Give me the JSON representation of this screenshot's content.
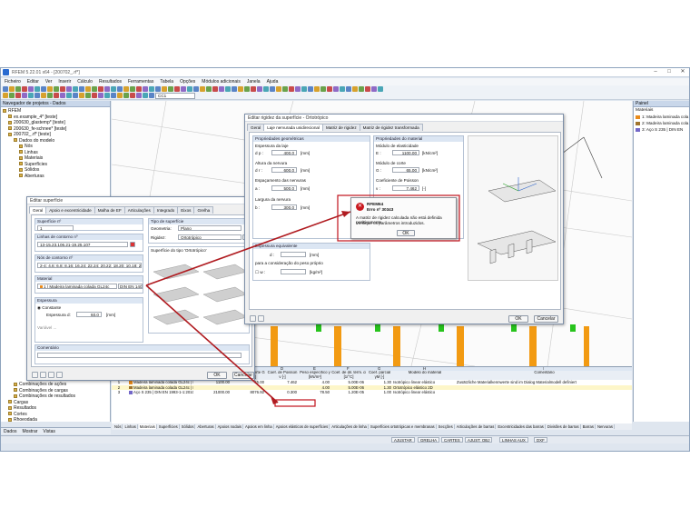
{
  "window": {
    "title": "RFEM 5.22.01 x64 - [200702_.rf*]",
    "min": "–",
    "max": "□",
    "close": "✕"
  },
  "menu": [
    "Ficheiro",
    "Editar",
    "Ver",
    "Inserir",
    "Cálculo",
    "Resultados",
    "Ferramentas",
    "Tabela",
    "Opções",
    "Módulos adicionais",
    "Janela",
    "Ajuda"
  ],
  "toolbar": {
    "loadcase": "CC1"
  },
  "navigator": {
    "header": "Navegador de projetos - Dados",
    "items": [
      {
        "label": "RFEM",
        "indent": 0
      },
      {
        "label": "ex.example_4* [teste]",
        "indent": 1
      },
      {
        "label": "200630_glastemp* [teste]",
        "indent": 1
      },
      {
        "label": "200630_fe-schnee* [teste]",
        "indent": 1
      },
      {
        "label": "200702_.rf* [teste]",
        "indent": 1
      },
      {
        "label": "Dados do modelo",
        "indent": 2
      },
      {
        "label": "Nós",
        "indent": 3
      },
      {
        "label": "Linhas",
        "indent": 3
      },
      {
        "label": "Materiais",
        "indent": 3
      },
      {
        "label": "Superfícies",
        "indent": 3
      },
      {
        "label": "Sólidos",
        "indent": 3
      },
      {
        "label": "Aberturas",
        "indent": 3
      }
    ],
    "lower_items": [
      {
        "label": "Combinações de ações",
        "indent": 2
      },
      {
        "label": "Combinações de cargas",
        "indent": 2
      },
      {
        "label": "Combinações de resultados",
        "indent": 2
      },
      {
        "label": "Cargas",
        "indent": 1
      },
      {
        "label": "Resultados",
        "indent": 1
      },
      {
        "label": "Cortes",
        "indent": 1
      },
      {
        "label": "Rhoeodada",
        "indent": 1
      }
    ],
    "tabs": [
      "Dados",
      "Mostrar",
      "Vistas"
    ]
  },
  "right_panel": {
    "header": "Painel",
    "subheader": "Materiais",
    "items": [
      {
        "label": "1: Madeira laminada cola",
        "color": "#e98b1c"
      },
      {
        "label": "2: Madeira laminada cola",
        "color": "#a0742e"
      },
      {
        "label": "3: Aço S 235 | DIN EN",
        "color": "#7367c8"
      }
    ]
  },
  "surface_dialog": {
    "title": "Editar superfície",
    "tabs": [
      "Geral",
      "Apoio e excentricidade",
      "Malha de EF",
      "Articulações",
      "Integrado",
      "Eixos",
      "Grelha"
    ],
    "surface_no_label": "Superfície nº",
    "surface_no": "1",
    "type_label": "Tipo de superfície",
    "geometry_label": "Geometria:",
    "geometry_value": "Plano",
    "stiffness_label": "Rigidez:",
    "stiffness_value": "Ortotrópico",
    "boundary_label": "Linhas de contorno nº",
    "boundary_value": "13-15,23,106,21-19,25,107",
    "boundary_nodes_label": "Nós de contorno nº",
    "boundary_nodes_value": "2-4; 4,6; 6,8; 8,16; 16,24; 22,24; 20,22; 18,20; 10,18; 2,10",
    "material_label": "Material",
    "material_no": "1",
    "material_value": "Madeira laminada colada GL24c",
    "material_norm": "DIN EN 14080:20",
    "preview_label": "Superfície do tipo 'Ortotrópico'",
    "thickness_label": "Espessura",
    "constant_label": "Constante",
    "variable_label": "Variável ...",
    "thickness_d_label": "Espessura d:",
    "thickness_d_value": "60.0",
    "thickness_unit": "[mm]",
    "comment_label": "Comentário",
    "ok": "OK",
    "cancel": "Cancelar"
  },
  "stiffness_dialog": {
    "title": "Editar rigidez da superfície - Ortotrópico",
    "tabs": [
      "Geral",
      "Laje nervurada unidirecional",
      "Matriz de rigidez",
      "Matriz de rigidez transformada"
    ],
    "geom_header": "Propriedades geométricas",
    "slab_thickness_label": "Espessura da laje",
    "dp_label": "d p :",
    "dp_value": "400.0",
    "rib_height_label": "Altura da nervura",
    "dr_label": "d r :",
    "dr_value": "600.0",
    "rib_spacing_label": "Espaçamento das nervuras",
    "a_label": "a :",
    "a_value": "500.0",
    "rib_width_label": "Largura da nervura",
    "b_label": "b :",
    "b_value": "300.0",
    "unit_mm": "[mm]",
    "mat_header": "Propriedades do material",
    "e_label": "Módulo de elasticidade",
    "e_sym": "E :",
    "e_value": "1100.00",
    "e_unit": "[kN/cm²]",
    "g_label": "Módulo de corte",
    "g_sym": "G :",
    "g_value": "65.00",
    "g_unit": "[kN/cm²]",
    "nu_label": "Coeficiente de Poisson",
    "nu_sym": "ν :",
    "nu_value": "7.462",
    "nu_unit": "[-]",
    "ym_sym": "γM :",
    "ym_value": "1.30",
    "ym_unit": "[-]",
    "eq_header": "Espessura equivalente",
    "eq_d_label": "d :",
    "eq_unit": "[mm]",
    "selfweight_label": "para a consideração do peso próprio",
    "w_label": "w :",
    "w_unit": "[kg/m²]",
    "ok": "OK",
    "cancel": "Cancelar"
  },
  "error": {
    "title": "RFEM64",
    "code": "Erro nº 30343",
    "message1": "A matriz de rigidez calculada não está definida positivamente.",
    "message2": "Verifique os parâmetros introduzidos.",
    "ok": "OK"
  },
  "table": {
    "headers_top": [
      "A",
      "B",
      "C",
      "D",
      "E",
      "F",
      "G",
      "H",
      "I"
    ],
    "headers": [
      "Material nº",
      "Descrição do material",
      "Módulo de elasticidade E [kN/cm²]",
      "Módulo de corte G [kN/cm²]",
      "Coef. de Poisson ν [-]",
      "Peso específico γ [kN/m³]",
      "Coef. de dil. térm. α [1/°C]",
      "Coef. parcial γM [-]",
      "Modelo do material",
      "Comentário"
    ],
    "rows": [
      {
        "no": "1",
        "desc": "Madeira laminada colada GL24c | DIN EN",
        "e": "1100.00",
        "g": "65.00",
        "nu": "7.462",
        "gamma": "4.00",
        "alpha": "5.00E-06",
        "ym": "1.30",
        "model": "Isotrópico linear elástico",
        "comment": "Zusätzliche Materialkennwerte sind im Dialog Materialmodell definiert",
        "color": "#e98b1c"
      },
      {
        "no": "2",
        "desc": "Madeira laminada colada GL24c | DIN EN",
        "e": "",
        "g": "",
        "nu": "",
        "gamma": "4.00",
        "alpha": "5.00E-06",
        "ym": "1.30",
        "model": "Ortotrópico elástico 2D",
        "comment": "",
        "color": "#a0742e"
      },
      {
        "no": "3",
        "desc": "Aço S 235 | DIN EN 1993-1-1:2010-12",
        "e": "21000.00",
        "g": "8076.92",
        "nu": "0.300",
        "gamma": "78.50",
        "alpha": "1.20E-05",
        "ym": "1.00",
        "model": "Isotrópico linear elástico",
        "comment": "",
        "color": "#7367c8"
      }
    ]
  },
  "sheet_tabs": [
    "Nós",
    "Linhas",
    "Materiais",
    "Superfícies",
    "Sólidos",
    "Aberturas",
    "Apoios nodais",
    "Apoios em linha",
    "Apoios elásticos de superfícies",
    "Articulações de linha",
    "Superfícies ortotrópicas e membranas",
    "Secções",
    "Articulações de barras",
    "Excentricidades das barras",
    "Divisões de barras",
    "Barras",
    "Nervuras"
  ],
  "status_buttons": [
    "AJUSTAR",
    "GRELHA",
    "CARTES",
    "AJUST. OBJ",
    "LINHAS AUX",
    "DXF"
  ],
  "colors": {
    "accent_red": "#c0121b",
    "arrow_red": "#b01b20",
    "timber": "#ef9a1d",
    "column": "#f29a12",
    "green_support": "#27c31c"
  }
}
